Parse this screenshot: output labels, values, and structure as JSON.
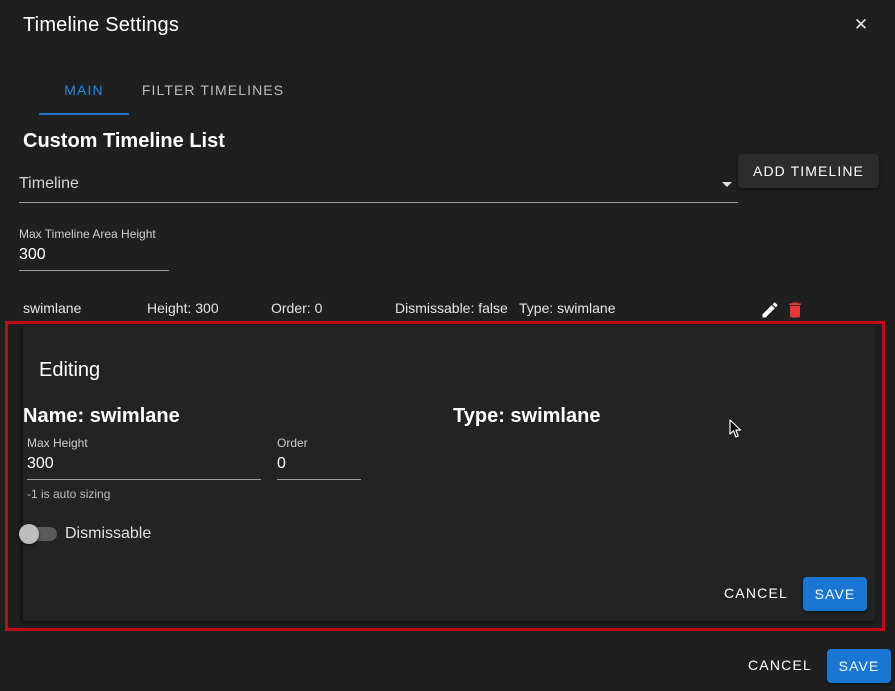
{
  "dialog": {
    "title": "Timeline Settings",
    "close_glyph": "✕"
  },
  "tabs": [
    {
      "label": "MAIN",
      "active": true
    },
    {
      "label": "FILTER TIMELINES",
      "active": false
    }
  ],
  "custom_list": {
    "title": "Custom Timeline List",
    "select_value": "Timeline",
    "add_button": "ADD TIMELINE"
  },
  "max_area": {
    "label": "Max Timeline Area Height",
    "value": "300"
  },
  "timeline_row": {
    "name": "swimlane",
    "height": "Height: 300",
    "order": "Order: 0",
    "dismissable": "Dismissable: false",
    "type": "Type: swimlane",
    "edit_icon": "pencil-icon",
    "delete_icon": "trash-icon"
  },
  "editing": {
    "title": "Editing",
    "name_heading": "Name: swimlane",
    "type_heading": "Type: swimlane",
    "max_height_label": "Max Height",
    "max_height_value": "300",
    "helper_text": "-1 is auto sizing",
    "order_label": "Order",
    "order_value": "0",
    "dismissable_label": "Dismissable",
    "dismissable_on": false,
    "cancel_label": "CANCEL",
    "save_label": "SAVE"
  },
  "footer": {
    "cancel_label": "CANCEL",
    "save_label": "SAVE"
  },
  "colors": {
    "background": "#1f1f1f",
    "accent": "#1976d2",
    "tab_active": "#1e88e5",
    "highlight_border": "#c20c13",
    "delete_icon": "#e53935"
  }
}
